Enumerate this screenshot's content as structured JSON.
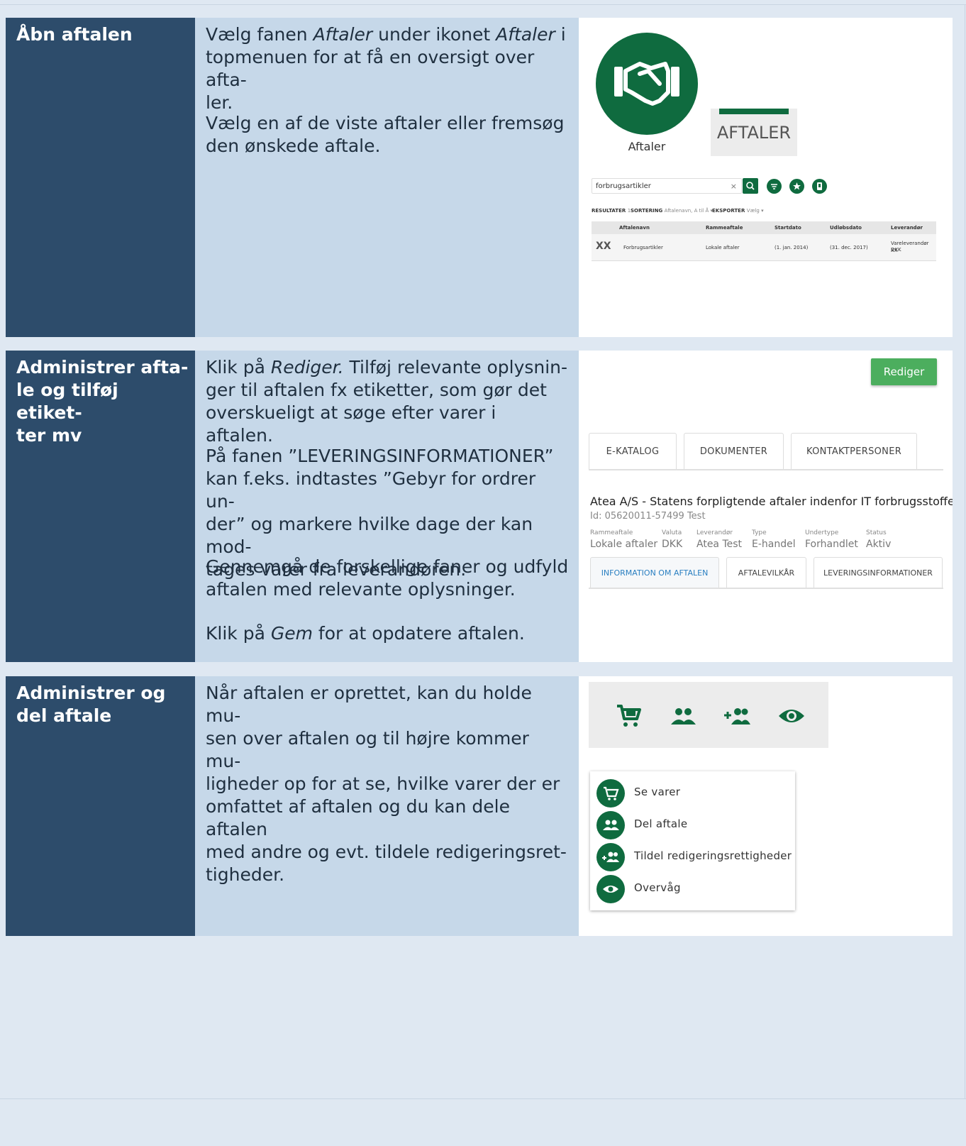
{
  "rows": [
    {
      "heading": "Åbn aftalen",
      "p1_a": "Vælg fanen ",
      "p1_b": "Aftaler",
      "p1_c": " under ikonet ",
      "p1_d": "Aftaler",
      "p1_e": " i\ntopmenuen for at få en oversigt over afta-\nler.",
      "p2": "Vælg en af de viste aftaler eller fremsøg\nden ønskede aftale.",
      "image": {
        "icon_label": "Aftaler",
        "tab_label": "AFTALER",
        "search_value": "forbrugsartikler",
        "search_clear": "×",
        "resultater_label": "RESULTATER",
        "resultater_count": "1",
        "sortering_label": "SORTERING",
        "sortering_value": "Aftalenavn, A til Å ▾",
        "eksporter_label": "EKSPORTER",
        "eksporter_value": "Vælg ▾",
        "columns": [
          "Aftalenavn",
          "Rammeaftale",
          "Startdato",
          "Udløbsdato",
          "Leverandør"
        ],
        "row_logo": "XX",
        "row": {
          "name": "Forbrugsartikler",
          "rammeaftale": "Lokale aftaler",
          "start": "(1. jan. 2014)",
          "end": "(31. dec. 2017)",
          "supplier_1": "Vareleverandør XX",
          "supplier_2": "DKK"
        }
      }
    },
    {
      "heading": "Administrer afta-\nle og tilføj etiket-\nter mv",
      "p1_a": "Klik på ",
      "p1_b": "Rediger.",
      "p1_c": " Tilføj relevante oplysnin-\nger til aftalen fx etiketter, som gør det\noverskueligt at søge efter varer i aftalen.",
      "p2": "På fanen ”LEVERINGSINFORMATIONER”\nkan f.eks. indtastes ”Gebyr for ordrer un-\nder” og markere hvilke dage der kan mod-\ntages varer fra leverandøren.",
      "p3": "Gennemgå de forskellige faner og udfyld\naftalen med relevante oplysninger.",
      "p4_a": "Klik på ",
      "p4_b": "Gem",
      "p4_c": " for at opdatere aftalen.",
      "image": {
        "rediger_label": "Rediger",
        "tabs": [
          "E-KATALOG",
          "DOKUMENTER",
          "KONTAKTPERSONER"
        ],
        "title": "Atea A/S - Statens forpligtende aftaler indenfor IT forbrugsstoffer",
        "id_text": "Id: 05620011-57499 Test",
        "meta": [
          {
            "label": "Rammeaftale",
            "value": "Lokale aftaler"
          },
          {
            "label": "Valuta",
            "value": "DKK"
          },
          {
            "label": "Leverandør",
            "value": "Atea Test"
          },
          {
            "label": "Type",
            "value": "E-handel"
          },
          {
            "label": "Undertype",
            "value": "Forhandlet"
          },
          {
            "label": "Status",
            "value": "Aktiv"
          }
        ],
        "subtabs": [
          "INFORMATION OM AFTALEN",
          "AFTALEVILKÅR",
          "LEVERINGSINFORMATIONER"
        ]
      }
    },
    {
      "heading": "Administrer og\ndel aftale",
      "p1": "Når aftalen er oprettet, kan du holde mu-\nsen over aftalen og til højre kommer mu-\nligheder op for at se, hvilke varer der er\nomfattet af aftalen og du kan dele aftalen\nmed andre og evt. tildele redigeringsret-\ntigheder.",
      "image": {
        "menu": [
          "Se varer",
          "Del aftale",
          "Tildel redigeringsrettigheder",
          "Overvåg"
        ]
      }
    }
  ],
  "colors": {
    "heading_bg": "#2d4c6b",
    "text_bg": "#c6d8e9",
    "brand_green": "#0f6b3f",
    "button_green": "#4cae5e"
  }
}
